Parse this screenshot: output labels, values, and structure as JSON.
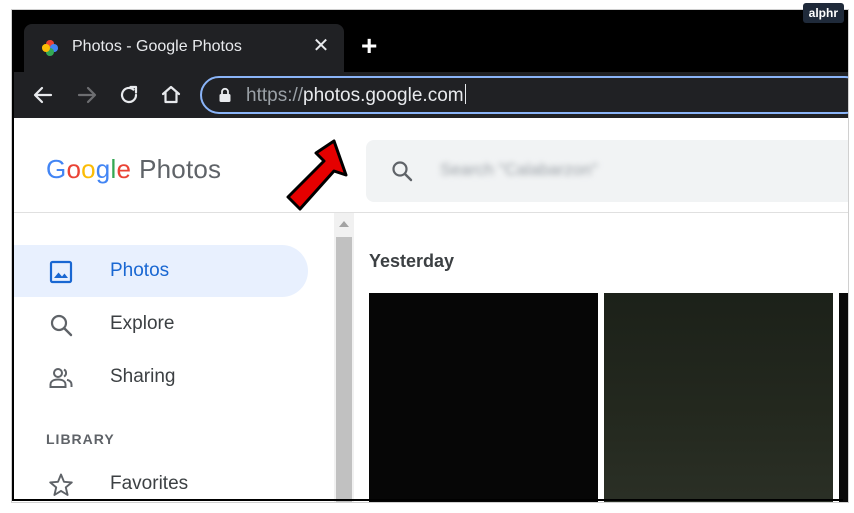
{
  "watermark": "alphr",
  "browser": {
    "tab_title": "Photos - Google Photos",
    "tab_close": "✕",
    "new_tab": "+",
    "url_scheme": "https://",
    "url_host": "photos.google.com"
  },
  "app": {
    "logo_google": [
      "G",
      "o",
      "o",
      "g",
      "l",
      "e"
    ],
    "logo_product": "Photos",
    "search_placeholder": "Search \"Calabarzon\""
  },
  "sidebar": {
    "items": [
      {
        "label": "Photos",
        "icon": "photo-icon",
        "active": true
      },
      {
        "label": "Explore",
        "icon": "search-icon",
        "active": false
      },
      {
        "label": "Sharing",
        "icon": "people-icon",
        "active": false
      }
    ],
    "section_label": "LIBRARY",
    "library_items": [
      {
        "label": "Favorites",
        "icon": "star-icon"
      }
    ]
  },
  "content": {
    "day_label": "Yesterday"
  },
  "colors": {
    "accent": "#1967d2",
    "active_bg": "#e8f0fe",
    "chrome_dark": "#202124",
    "annotation_arrow": "#e50000"
  }
}
